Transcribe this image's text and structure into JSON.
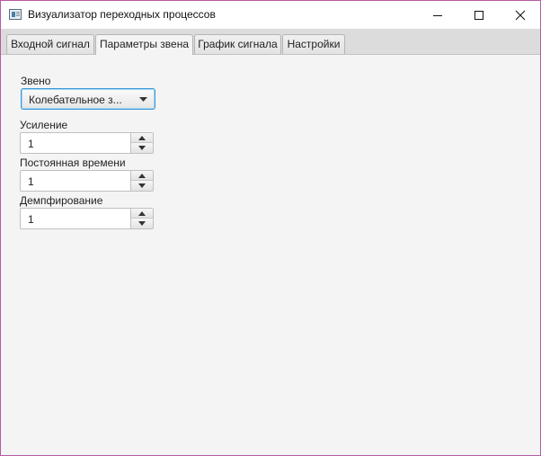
{
  "window": {
    "title": "Визуализатор переходных процессов",
    "controls": {
      "minimize": "minimize-icon",
      "maximize": "maximize-icon",
      "close": "close-icon"
    }
  },
  "tabs": [
    {
      "label": "Входной сигнал",
      "active": false
    },
    {
      "label": "Параметры звена",
      "active": true
    },
    {
      "label": "График сигнала",
      "active": false
    },
    {
      "label": "Настройки",
      "active": false
    }
  ],
  "form": {
    "link_label": "Звено",
    "link_value": "Колебательное з...",
    "gain_label": "Усиление",
    "gain_value": "1",
    "time_constant_label": "Постоянная времени",
    "time_constant_value": "1",
    "damping_label": "Демпфирование",
    "damping_value": "1"
  },
  "colors": {
    "window_border": "#b65aa4",
    "focus_accent": "#3a9ad9",
    "background": "#f4f4f4"
  }
}
